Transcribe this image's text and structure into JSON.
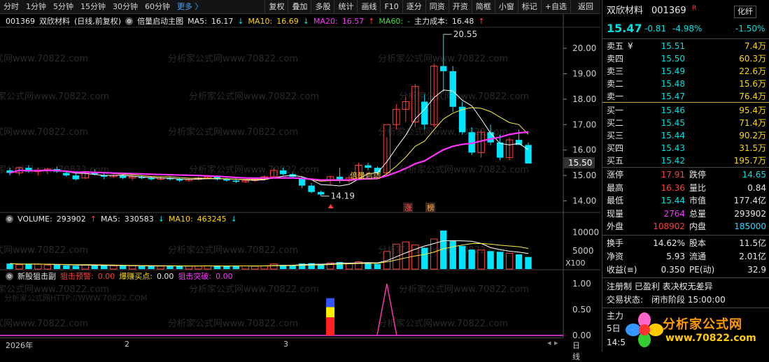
{
  "toolbar": {
    "period_tabs": [
      "分时",
      "1分钟",
      "5分钟",
      "15分钟",
      "30分钟",
      "60分钟"
    ],
    "more": "更多",
    "buttons": [
      "复权",
      "叠加",
      "多股",
      "统计",
      "画线",
      "F10",
      "逐分",
      "同资",
      "开资",
      "简框",
      "小窗",
      "标记",
      "+自选",
      "返回"
    ]
  },
  "info": {
    "code": "001369",
    "name": "双欣材料",
    "mode": "(日线,前复权)",
    "indicator": "倍量启动主图",
    "ma5_label": "MA5:",
    "ma5": "16.17",
    "ma10_label": "MA10:",
    "ma10": "16.69",
    "ma20_label": "MA20:",
    "ma20": "16.57",
    "ma60_label": "MA60:",
    "ma60": "-",
    "cost_label": "主力成本:",
    "cost": "16.48"
  },
  "price_axis": [
    "20.00",
    "19.00",
    "18.00",
    "17.00",
    "16.00",
    "15.00",
    "14.00"
  ],
  "price_tag": "15.50",
  "annotations": {
    "high": "20.55",
    "low": "14.19",
    "start": "倍量启动",
    "zhang": "涨",
    "bang": "榜"
  },
  "volume": {
    "label": "VOLUME:",
    "value": "293902",
    "ma5_label": "MA5:",
    "ma5": "330583",
    "ma10_label": "MA10:",
    "ma10": "463245",
    "axis": [
      "10000",
      "5000"
    ],
    "unit": "X100"
  },
  "indicator2": {
    "name": "新股狙击副",
    "l1_label": "狙击预警:",
    "l1": "0.00",
    "l2_label": "爆赚买点:",
    "l2": "0.00",
    "l3_label": "狙击突破:",
    "l3": "0.00",
    "axis": [
      "1.00",
      "0.50",
      "0.00"
    ]
  },
  "xaxis": {
    "labels": [
      "2026年",
      "2",
      "3"
    ],
    "period": "日线"
  },
  "watermark": "分析家公式网www.70822.com",
  "watermark_small": "分析家公式网HTTP://WWW.70822.COM",
  "chart_data": {
    "type": "candlestick",
    "title": "双欣材料 001369 日线 前复权",
    "ylim": [
      13.6,
      20.8
    ],
    "high_mark": 20.55,
    "low_mark": 14.19,
    "candles": [
      [
        15.2,
        15.3,
        15.0,
        15.1
      ],
      [
        15.1,
        15.35,
        15.0,
        15.3
      ],
      [
        15.3,
        15.4,
        15.1,
        15.15
      ],
      [
        15.15,
        15.3,
        15.0,
        15.2
      ],
      [
        15.2,
        15.3,
        15.05,
        15.25
      ],
      [
        15.25,
        15.35,
        15.1,
        15.15
      ],
      [
        15.1,
        15.2,
        14.95,
        15.0
      ],
      [
        15.0,
        15.1,
        14.8,
        14.85
      ],
      [
        14.9,
        15.2,
        14.85,
        15.15
      ],
      [
        15.1,
        15.25,
        15.0,
        15.05
      ],
      [
        15.0,
        15.1,
        14.85,
        14.95
      ],
      [
        14.95,
        15.05,
        14.9,
        15.0
      ],
      [
        15.0,
        15.05,
        14.85,
        14.9
      ],
      [
        14.9,
        15.0,
        14.8,
        14.95
      ],
      [
        14.95,
        15.0,
        14.85,
        14.9
      ],
      [
        14.9,
        14.95,
        14.8,
        14.85
      ],
      [
        14.85,
        14.95,
        14.8,
        14.9
      ],
      [
        14.9,
        14.95,
        14.8,
        14.85
      ],
      [
        14.85,
        14.9,
        14.75,
        14.8
      ],
      [
        14.8,
        14.9,
        14.75,
        14.85
      ],
      [
        14.85,
        14.95,
        14.8,
        14.9
      ],
      [
        14.9,
        15.0,
        14.85,
        14.95
      ],
      [
        14.95,
        15.0,
        14.8,
        14.85
      ],
      [
        14.85,
        14.9,
        14.75,
        14.8
      ],
      [
        14.8,
        14.9,
        14.7,
        14.75
      ],
      [
        14.75,
        14.85,
        14.7,
        14.8
      ],
      [
        14.8,
        14.9,
        14.75,
        14.85
      ],
      [
        14.85,
        15.0,
        14.8,
        14.95
      ],
      [
        14.95,
        15.3,
        14.9,
        15.2
      ],
      [
        15.2,
        15.3,
        15.0,
        15.05
      ],
      [
        15.05,
        15.1,
        14.9,
        14.95
      ],
      [
        14.9,
        14.95,
        14.5,
        14.6
      ],
      [
        14.6,
        14.7,
        14.3,
        14.35
      ],
      [
        14.35,
        14.4,
        14.19,
        14.25
      ],
      [
        14.8,
        15.0,
        14.6,
        14.95
      ],
      [
        14.95,
        15.3,
        14.7,
        14.8
      ],
      [
        14.8,
        15.0,
        14.7,
        14.9
      ],
      [
        14.9,
        15.5,
        14.85,
        15.4
      ],
      [
        15.4,
        15.5,
        15.2,
        15.3
      ],
      [
        15.3,
        15.35,
        15.0,
        15.1
      ],
      [
        15.1,
        16.5,
        15.0,
        17.0
      ],
      [
        17.0,
        17.8,
        16.8,
        17.6
      ],
      [
        17.6,
        18.1,
        17.1,
        17.9
      ],
      [
        17.1,
        18.6,
        16.9,
        18.5
      ],
      [
        17.9,
        18.2,
        16.8,
        17.0
      ],
      [
        17.0,
        19.4,
        16.9,
        19.3
      ],
      [
        19.3,
        20.55,
        18.3,
        19.1
      ],
      [
        19.1,
        19.3,
        17.5,
        17.7
      ],
      [
        17.7,
        17.9,
        16.6,
        16.7
      ],
      [
        16.7,
        16.9,
        15.8,
        15.9
      ],
      [
        15.9,
        16.8,
        15.7,
        16.7
      ],
      [
        16.7,
        17.0,
        16.2,
        16.3
      ],
      [
        16.3,
        16.6,
        15.6,
        15.7
      ],
      [
        15.7,
        16.5,
        15.6,
        16.4
      ],
      [
        16.4,
        16.8,
        16.2,
        16.2
      ],
      [
        16.2,
        16.3,
        15.5,
        15.47
      ]
    ]
  },
  "right": {
    "name": "双欣材料",
    "code": "001369",
    "badge": "R",
    "industry": "化纤",
    "price": "15.47",
    "change": "-0.81",
    "pct": "-4.98%",
    "industry_pct": "-1.50%",
    "asks": [
      {
        "label": "卖五",
        "mark": "¥",
        "price": "15.51",
        "vol": "7.4万"
      },
      {
        "label": "卖四",
        "mark": "",
        "price": "15.50",
        "vol": "60.3万"
      },
      {
        "label": "卖三",
        "mark": "",
        "price": "15.49",
        "vol": "22.6万"
      },
      {
        "label": "卖二",
        "mark": "",
        "price": "15.48",
        "vol": "15.6万"
      },
      {
        "label": "卖一",
        "mark": "",
        "price": "15.47",
        "vol": "76.4万"
      }
    ],
    "bids": [
      {
        "label": "买一",
        "price": "15.46",
        "vol": "95.4万"
      },
      {
        "label": "买二",
        "price": "15.45",
        "vol": "71.4万"
      },
      {
        "label": "买三",
        "price": "15.44",
        "vol": "90.2万"
      },
      {
        "label": "买四",
        "price": "15.43",
        "vol": "31.5万"
      },
      {
        "label": "买五",
        "price": "15.42",
        "vol": "195.7万"
      }
    ],
    "stats1": [
      {
        "l1": "涨停",
        "v1": "17.91",
        "l2": "跌停",
        "v2": "14.65"
      },
      {
        "l1": "最高",
        "v1": "16.36",
        "l2": "量比",
        "v2": "0.84"
      },
      {
        "l1": "最低",
        "v1": "15.44",
        "l2": "市值",
        "v2": "177.4亿"
      },
      {
        "l1": "现量",
        "v1": "2764",
        "l2": "总量",
        "v2": "293902"
      },
      {
        "l1": "外盘",
        "v1": "108902",
        "l2": "内盘",
        "v2": "185000"
      }
    ],
    "stats2": [
      {
        "l1": "换手",
        "v1": "14.62%",
        "l2": "股本",
        "v2": "11.5亿"
      },
      {
        "l1": "净资",
        "v1": "5.93",
        "l2": "流通",
        "v2": "2.01亿"
      },
      {
        "l1": "收益(≡)",
        "v1": "0.350",
        "l2": "PE(动)",
        "v2": "32.9"
      }
    ],
    "tags": "注册制 已盈利 表决权无差异",
    "status_label": "交易状态:",
    "status": "闭市阶段 15:00:00",
    "row_a": "主力",
    "row_b": "5日",
    "row_c": "14:5",
    "logo_text": "分析家公式网",
    "logo_url": "www.70822.com"
  },
  "colors": {
    "up": "#ff3d3d",
    "down": "#00e5ff",
    "ma5": "#ffffff",
    "ma10": "#ffee44",
    "ma20": "#ff33ff"
  }
}
